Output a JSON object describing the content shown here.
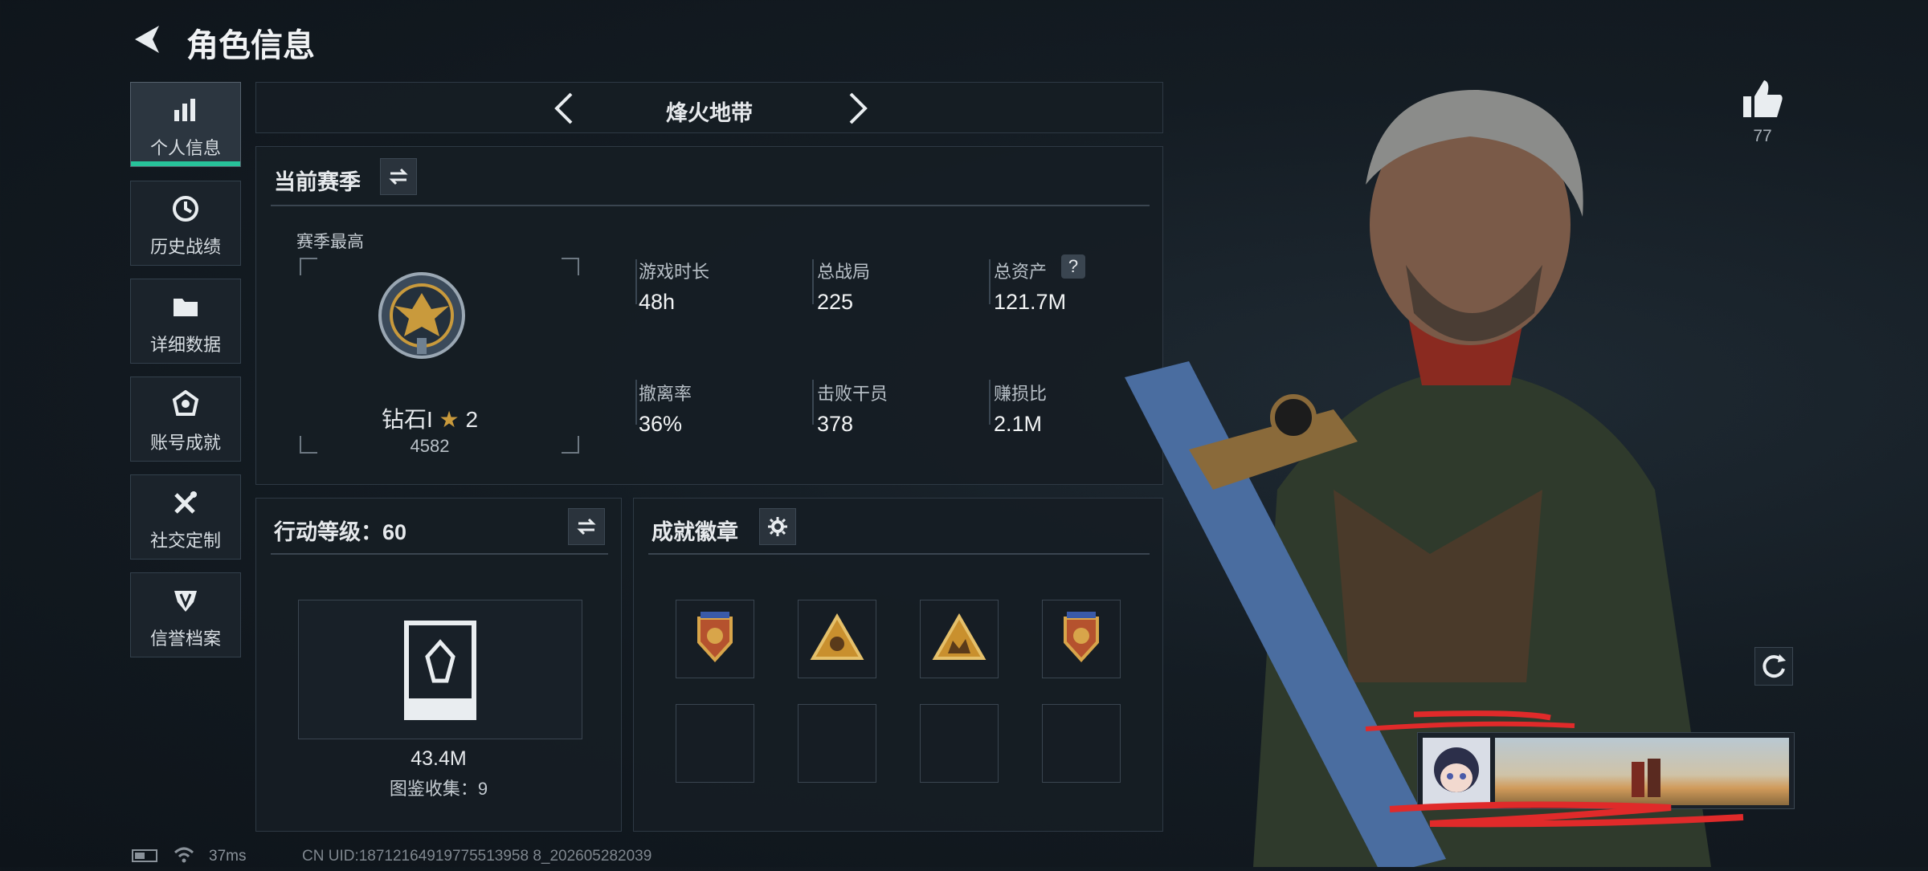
{
  "header": {
    "title": "角色信息"
  },
  "sidebar": {
    "items": [
      {
        "label": "个人信息",
        "icon": "bar-chart-icon"
      },
      {
        "label": "历史战绩",
        "icon": "clock-icon"
      },
      {
        "label": "详细数据",
        "icon": "folder-icon"
      },
      {
        "label": "账号成就",
        "icon": "achievement-icon"
      },
      {
        "label": "社交定制",
        "icon": "tools-icon"
      },
      {
        "label": "信誉档案",
        "icon": "shield-icon"
      }
    ]
  },
  "mode_selector": {
    "label": "烽火地带"
  },
  "season": {
    "title": "当前赛季",
    "best_label": "赛季最高",
    "rank_text": "钻石I",
    "stars": "2",
    "rank_score": "4582",
    "stats": [
      {
        "label": "游戏时长",
        "value": "48h"
      },
      {
        "label": "总战局",
        "value": "225"
      },
      {
        "label": "总资产",
        "value": "121.7M"
      },
      {
        "label": "撤离率",
        "value": "36%"
      },
      {
        "label": "击败干员",
        "value": "378"
      },
      {
        "label": "赚损比",
        "value": "2.1M"
      }
    ]
  },
  "action_level": {
    "title": "行动等级：60",
    "value": "43.4M",
    "collection": "图鉴收集：9"
  },
  "badges": {
    "title": "成就徽章"
  },
  "likes": {
    "count": "77"
  },
  "status_bar": {
    "ping": "37ms",
    "uid": "CN UID:18712164919775513958 8_202605282039"
  },
  "colors": {
    "accent_green": "#27c29a",
    "gold": "#c99a3c"
  }
}
